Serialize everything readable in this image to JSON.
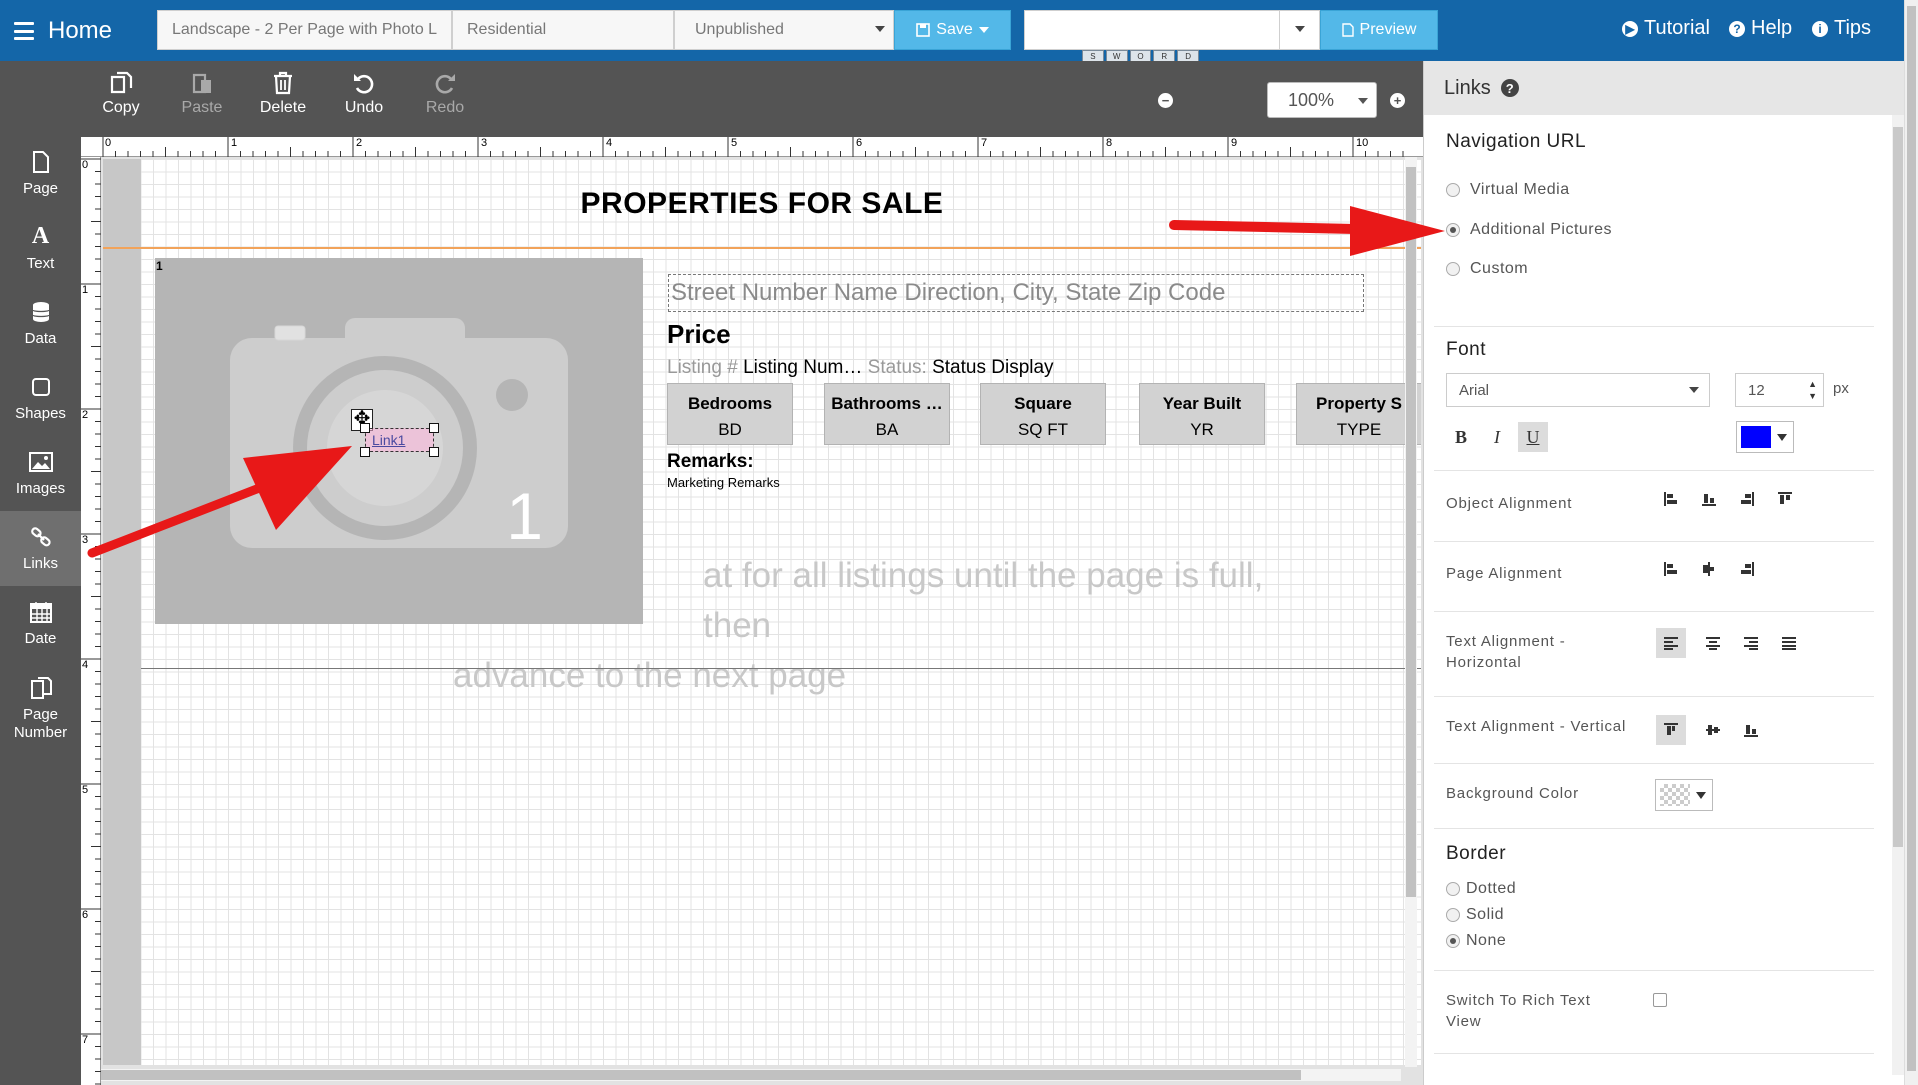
{
  "topbar": {
    "home_label": "Home",
    "template_name": "Landscape - 2 Per Page with Photo L",
    "property_type": "Residential",
    "status": "Unpublished",
    "save_label": "Save",
    "preview_field_value": "",
    "preview_label": "Preview",
    "tutorial_label": "Tutorial",
    "help_label": "Help",
    "tips_label": "Tips",
    "mini_strip": [
      "S",
      "W",
      "O",
      "R",
      "D"
    ]
  },
  "leftbar": {
    "items": [
      {
        "label": "Page",
        "icon": "page-icon"
      },
      {
        "label": "Text",
        "icon": "text-icon"
      },
      {
        "label": "Data",
        "icon": "database-icon"
      },
      {
        "label": "Shapes",
        "icon": "shapes-icon"
      },
      {
        "label": "Images",
        "icon": "image-icon"
      },
      {
        "label": "Links",
        "icon": "link-icon",
        "active": true
      },
      {
        "label": "Date",
        "icon": "calendar-icon"
      },
      {
        "label": "Page Number",
        "icon": "page-number-icon"
      }
    ]
  },
  "toolbar": {
    "copy": "Copy",
    "paste": "Paste",
    "delete": "Delete",
    "undo": "Undo",
    "redo": "Redo",
    "zoom": "100%"
  },
  "ruler": {
    "top_labels": [
      "0",
      "1",
      "2",
      "3",
      "4",
      "5",
      "6",
      "7",
      "8",
      "9",
      "10"
    ],
    "left_labels": [
      "0",
      "1",
      "2",
      "3",
      "4",
      "5",
      "6",
      "7"
    ]
  },
  "canvas": {
    "title": "PROPERTIES FOR SALE",
    "card_number": "1",
    "photo_number": "1",
    "address_placeholder": "Street Number Name Direction, City, State Zip Code",
    "price": "Price",
    "listing_label": "Listing #",
    "listing_value": "Listing Num…",
    "status_label": "Status:",
    "status_value": "Status Display",
    "stats": [
      {
        "label": "Bedrooms",
        "value": "BD"
      },
      {
        "label": "Bathrooms …",
        "value": "BA"
      },
      {
        "label": "Square",
        "value": "SQ FT"
      },
      {
        "label": "Year Built",
        "value": "YR"
      },
      {
        "label": "Property S",
        "value": "TYPE"
      }
    ],
    "remarks_label": "Remarks:",
    "remarks_value": "Marketing Remarks",
    "ghost_line1": "at for all listings until the page is full, then",
    "ghost_line2": "advance to the next page",
    "link_text": "Link1"
  },
  "panel": {
    "title": "Links",
    "nav_title": "Navigation URL",
    "nav_options": [
      {
        "label": "Virtual Media",
        "checked": false
      },
      {
        "label": "Additional Pictures",
        "checked": true
      },
      {
        "label": "Custom",
        "checked": false
      }
    ],
    "font_title": "Font",
    "font_family": "Arial",
    "font_size": "12",
    "font_unit": "px",
    "bold": "B",
    "italic": "I",
    "underline": "U",
    "font_color": "#0000ff",
    "object_alignment": "Object Alignment",
    "page_alignment": "Page Alignment",
    "text_align_h": "Text Alignment - Horizontal",
    "text_align_v": "Text Alignment - Vertical",
    "background_color": "Background Color",
    "border_title": "Border",
    "border_options": [
      {
        "label": "Dotted",
        "checked": false
      },
      {
        "label": "Solid",
        "checked": false
      },
      {
        "label": "None",
        "checked": true
      }
    ],
    "rich_text": "Switch To Rich Text View"
  },
  "colors": {
    "brand_blue": "#1466a8",
    "button_blue": "#53b8e8",
    "sidebar_gray": "#545454",
    "annotation_red": "#e81818"
  }
}
